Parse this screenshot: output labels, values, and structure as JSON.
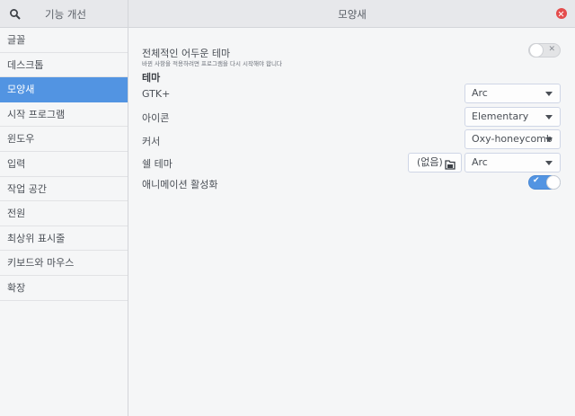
{
  "app": {
    "title": "기능 개선"
  },
  "window": {
    "title": "모양새"
  },
  "sidebar": {
    "items": [
      {
        "label": "글꼴"
      },
      {
        "label": "데스크톱"
      },
      {
        "label": "모양새"
      },
      {
        "label": "시작 프로그램"
      },
      {
        "label": "윈도우"
      },
      {
        "label": "입력"
      },
      {
        "label": "작업 공간"
      },
      {
        "label": "전원"
      },
      {
        "label": "최상위 표시줄"
      },
      {
        "label": "키보드와 마우스"
      },
      {
        "label": "확장"
      }
    ],
    "active": "모양새"
  },
  "main": {
    "dark_theme": {
      "label": "전체적인 어두운 테마",
      "sublabel": "바뀐 사항을 적용하려면 프로그램을 다시 시작해야 합니다",
      "enabled": false
    },
    "section_heading": "테마",
    "gtk": {
      "label": "GTK+",
      "value": "Arc"
    },
    "icons": {
      "label": "아이콘",
      "value": "Elementary"
    },
    "cursor": {
      "label": "커서",
      "value": "Oxy-honeycomb"
    },
    "shell": {
      "label": "쉘 테마",
      "file_value": "(없음)",
      "value": "Arc"
    },
    "animations": {
      "label": "애니메이션 활성화",
      "enabled": true
    }
  },
  "colors": {
    "accent": "#5294e2",
    "close": "#e44c4c"
  },
  "icons": [
    "search-icon",
    "close-icon",
    "file-open-icon",
    "chevron-down-icon",
    "check-icon",
    "x-icon"
  ]
}
